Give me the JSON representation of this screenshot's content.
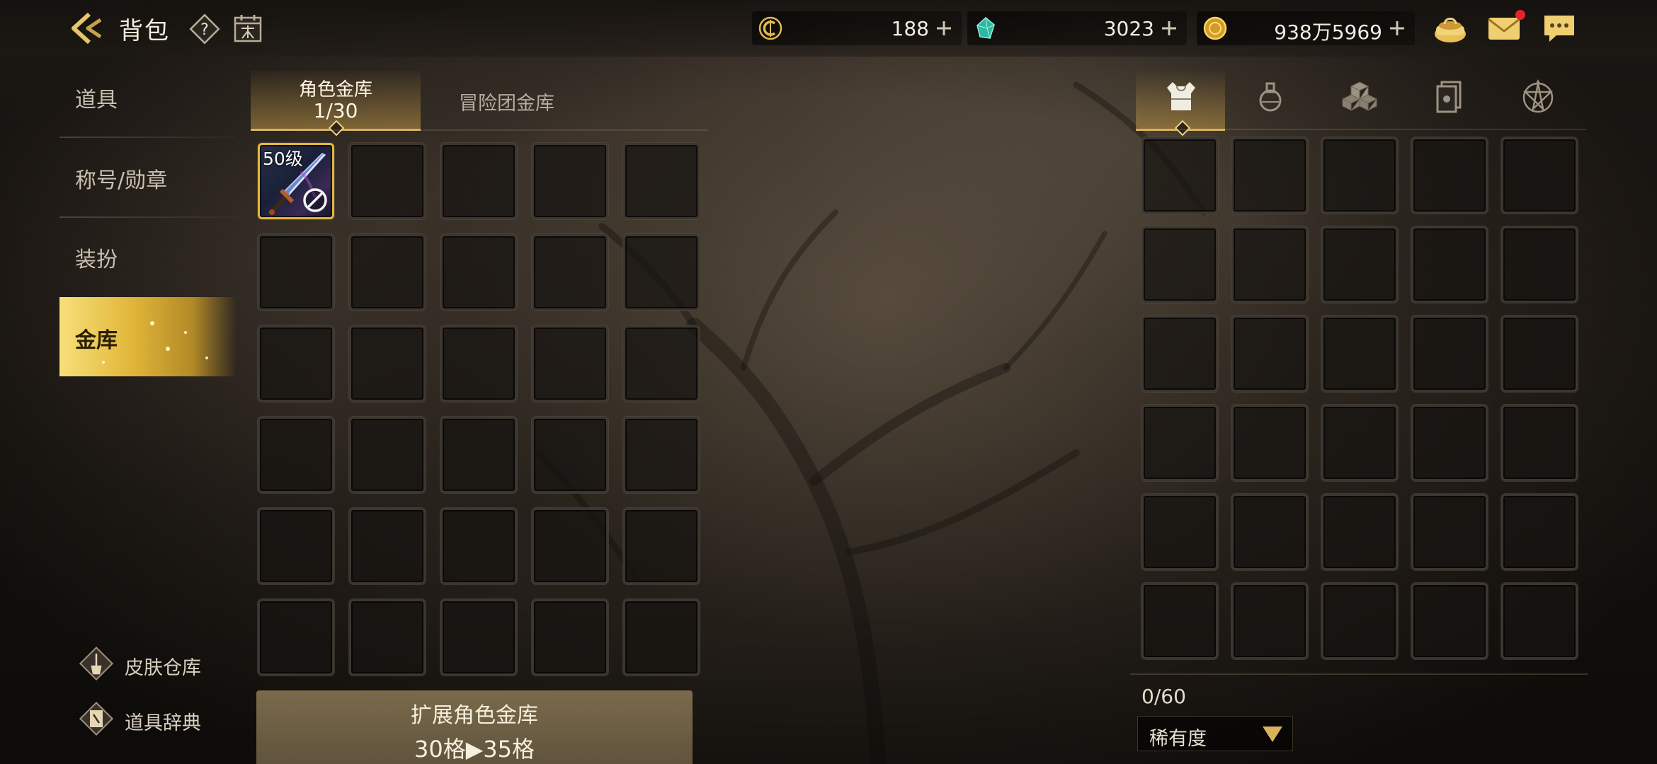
{
  "header": {
    "title": "背包",
    "back_icon": "back-arrow-icon",
    "help_icon": "question-icon",
    "calendar_icon": "calendar-icon"
  },
  "currencies": [
    {
      "icon": "c-coin-icon",
      "amount": "188"
    },
    {
      "icon": "crystal-icon",
      "amount": "3023"
    },
    {
      "icon": "gold-coin-icon",
      "amount": "938万5969"
    }
  ],
  "top_icons": [
    "money-pouch-icon",
    "mail-icon",
    "chat-icon"
  ],
  "colors": {
    "accent": "#e2b73a",
    "notification": "#e2242b"
  },
  "sidebar": {
    "items": [
      {
        "label": "道具",
        "active": false
      },
      {
        "label": "称号/勋章",
        "active": false
      },
      {
        "label": "装扮",
        "active": false
      },
      {
        "label": "金库",
        "active": true
      }
    ],
    "links": [
      {
        "label": "皮肤仓库",
        "icon": "brush-icon"
      },
      {
        "label": "道具辞典",
        "icon": "book-icon"
      }
    ]
  },
  "vault": {
    "tabs": [
      {
        "label": "角色金库",
        "count": "1/30",
        "active": true
      },
      {
        "label": "冒险团金库",
        "active": false
      }
    ],
    "items": [
      {
        "level": "50级",
        "icon": "sword-icon",
        "status_icon": "ban-icon"
      }
    ],
    "expand_button": {
      "title": "扩展角色金库",
      "detail": "30格▶35格"
    }
  },
  "inventory": {
    "category_tabs": [
      "armor-icon",
      "potion-icon",
      "cubes-icon",
      "cards-icon",
      "pentagram-icon"
    ],
    "active_tab": 0,
    "capacity": "0/60",
    "sort": {
      "selected": "稀有度"
    }
  }
}
